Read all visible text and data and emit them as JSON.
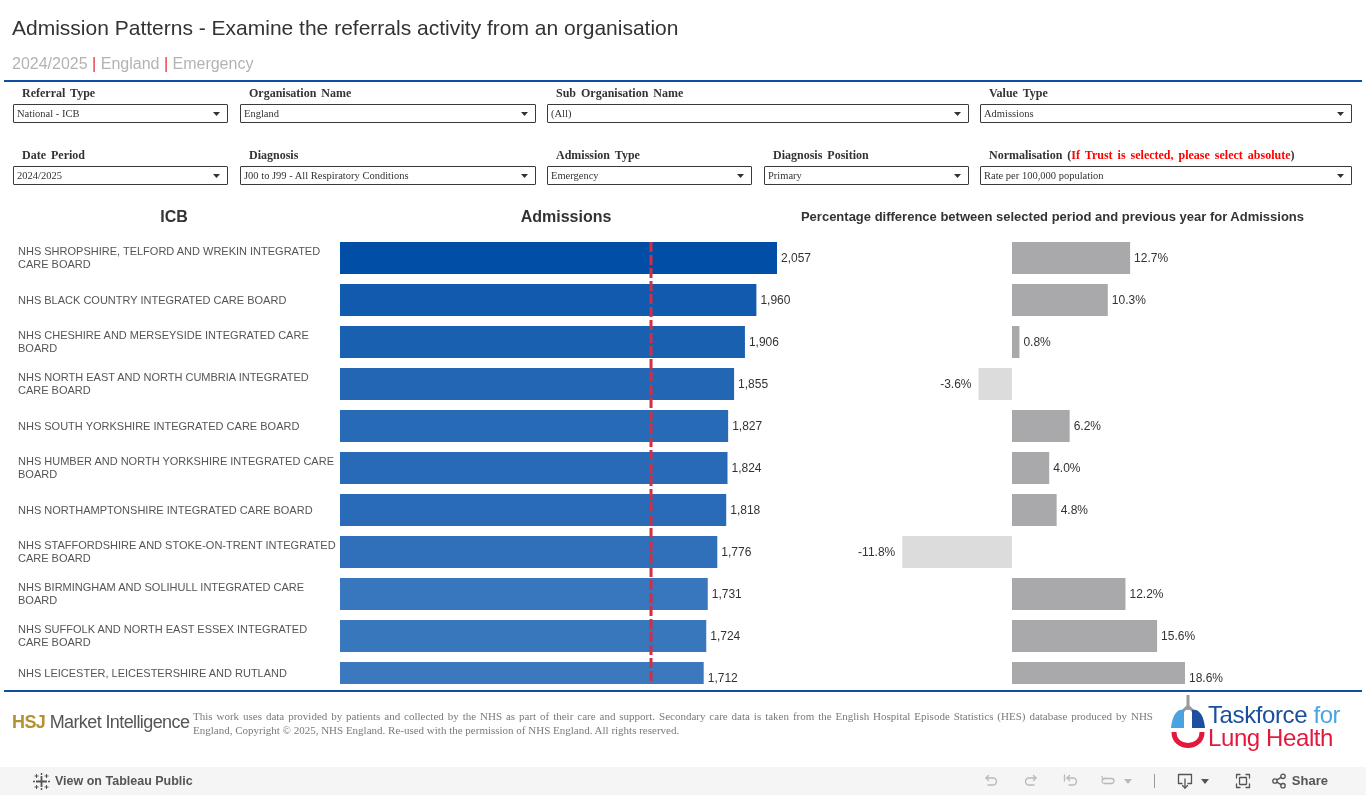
{
  "title": "Admission Patterns - Examine the referrals activity from an organisation",
  "subtitle": [
    {
      "text": "2024/2025",
      "kind": "value"
    },
    {
      "text": "|",
      "kind": "separator"
    },
    {
      "text": "England",
      "kind": "value"
    },
    {
      "text": "|",
      "kind": "separator"
    },
    {
      "text": "Emergency",
      "kind": "value"
    }
  ],
  "filter_rows": [
    {
      "filters": [
        {
          "label": "Referral Type",
          "value": "National - ICB"
        },
        {
          "label": "Organisation Name",
          "value": "England"
        },
        {
          "label": "Sub Organisation Name",
          "value": "(All)"
        },
        {
          "label": "Value Type",
          "value": "Admissions"
        }
      ]
    },
    {
      "filters": [
        {
          "label": "Date Period",
          "value": "2024/2025"
        },
        {
          "label": "Diagnosis",
          "value": "J00 to J99 - All Respiratory Conditions"
        },
        {
          "label": "Admission Type",
          "value": "Emergency"
        },
        {
          "label": "Diagnosis Position",
          "value": "Primary"
        },
        {
          "label_parts": [
            {
              "text": "Normalisation (",
              "kind": "plain"
            },
            {
              "text": "If Trust is selected, please select absolute",
              "kind": "warning"
            },
            {
              "text": ")",
              "kind": "plain"
            }
          ],
          "value": "Rate per 100,000 population"
        }
      ]
    }
  ],
  "admissions_chart": {
    "chart_data": {
      "type": "bar",
      "orientation": "horizontal",
      "title": "Admissions",
      "ylabel": "ICB",
      "categories": [
        "NHS SHROPSHIRE, TELFORD AND WREKIN INTEGRATED CARE BOARD",
        "NHS BLACK COUNTRY INTEGRATED CARE BOARD",
        "NHS CHESHIRE AND MERSEYSIDE INTEGRATED CARE BOARD",
        "NHS NORTH EAST AND NORTH CUMBRIA INTEGRATED CARE BOARD",
        "NHS SOUTH YORKSHIRE INTEGRATED CARE BOARD",
        "NHS HUMBER AND NORTH YORKSHIRE INTEGRATED CARE BOARD",
        "NHS NORTHAMPTONSHIRE INTEGRATED CARE BOARD",
        "NHS STAFFORDSHIRE AND STOKE-ON-TRENT INTEGRATED CARE BOARD",
        "NHS BIRMINGHAM AND SOLIHULL INTEGRATED CARE BOARD",
        "NHS SUFFOLK AND NORTH EAST ESSEX INTEGRATED CARE BOARD",
        "NHS LEICESTER, LEICESTERSHIRE AND RUTLAND"
      ],
      "values": [
        2057,
        1960,
        1906,
        1855,
        1827,
        1824,
        1818,
        1776,
        1731,
        1724,
        1712
      ],
      "value_labels": [
        "2,057",
        "1,960",
        "1,906",
        "1,855",
        "1,827",
        "1,824",
        "1,818",
        "1,776",
        "1,731",
        "1,724",
        "1,712"
      ],
      "ref_lines": [
        {
          "axis": "x",
          "value": 1464
        }
      ]
    }
  },
  "change_chart": {
    "chart_data": {
      "type": "bar",
      "orientation": "horizontal",
      "title": "Percentage difference between selected period and previous year for Admissions",
      "values": [
        12.7,
        10.3,
        0.8,
        -3.6,
        6.2,
        4.0,
        4.8,
        -11.8,
        12.2,
        15.6,
        18.6
      ],
      "value_labels": [
        "12.7%",
        "10.3%",
        "0.8%",
        "-3.6%",
        "6.2%",
        "4.0%",
        "4.8%",
        "-11.8%",
        "12.2%",
        "15.6%",
        "18.6%"
      ]
    }
  },
  "footer": {
    "publisher_logo": {
      "mark": "HSJ",
      "name": "Market Intelligence"
    },
    "disclaimer": "This work uses data provided by patients and collected by the NHS as part of their care and support. Secondary care data is taken from the English Hospital Episode Statistics (HES) database produced by NHS England, Copyright © 2025, NHS England. Re-used with the permission of NHS England. All rights reserved.",
    "partner_logo": {
      "parts": [
        {
          "text": "Taskforce",
          "kind": "primary"
        },
        {
          "text": "for",
          "kind": "secondary"
        },
        {
          "text": "Lung Health",
          "kind": "accent"
        }
      ]
    }
  },
  "toolbar": {
    "link": "View on Tableau Public",
    "history_actions": [
      {
        "kind": "undo",
        "disabled": true,
        "menu": false
      },
      {
        "kind": "redo",
        "disabled": true,
        "menu": false
      },
      {
        "kind": "revert",
        "disabled": true,
        "menu": false
      },
      {
        "kind": "refresh",
        "disabled": true,
        "menu": true
      }
    ],
    "view_actions": [
      {
        "kind": "download",
        "disabled": false,
        "menu": true
      },
      {
        "kind": "fullscreen",
        "disabled": false,
        "menu": false
      },
      {
        "kind": "share",
        "disabled": false,
        "menu": false,
        "label": "Share"
      }
    ]
  }
}
